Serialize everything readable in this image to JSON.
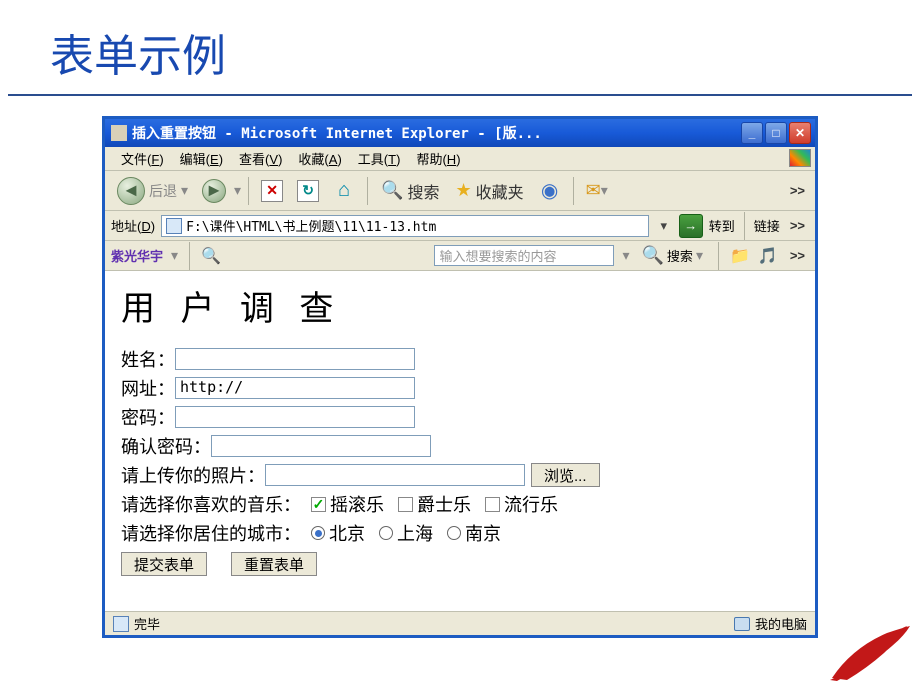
{
  "slide": {
    "title": "表单示例"
  },
  "titlebar": {
    "text": "插入重置按钮 - Microsoft Internet Explorer - [版..."
  },
  "menu": {
    "file": "文件",
    "file_u": "F",
    "edit": "编辑",
    "edit_u": "E",
    "view": "查看",
    "view_u": "V",
    "fav": "收藏",
    "fav_u": "A",
    "tools": "工具",
    "tools_u": "T",
    "help": "帮助",
    "help_u": "H"
  },
  "toolbar": {
    "back": "后退",
    "search": "搜索",
    "favorites": "收藏夹",
    "overflow": ">>"
  },
  "addressbar": {
    "label": "地址",
    "label_u": "D",
    "path": "F:\\课件\\HTML\\书上例题\\11\\11-13.htm",
    "go": "转到",
    "links": "链接",
    "overflow": ">>"
  },
  "extra": {
    "brand": "紫光华宇",
    "search_ph": "输入想要搜索的内容",
    "search_btn": "搜索"
  },
  "page": {
    "heading": "用 户 调 查",
    "name_label": "姓名：",
    "url_label": "网址：",
    "url_value": "http://",
    "password_label": "密码：",
    "confirm_label": "确认密码：",
    "upload_label": "请上传你的照片：",
    "browse_btn": "浏览...",
    "music_label": "请选择你喜欢的音乐：",
    "music_opts": {
      "rock": "摇滚乐",
      "jazz": "爵士乐",
      "pop": "流行乐"
    },
    "city_label": "请选择你居住的城市：",
    "city_opts": {
      "bj": "北京",
      "sh": "上海",
      "nj": "南京"
    },
    "submit": "提交表单",
    "reset": "重置表单"
  },
  "status": {
    "done": "完毕",
    "zone": "我的电脑"
  }
}
